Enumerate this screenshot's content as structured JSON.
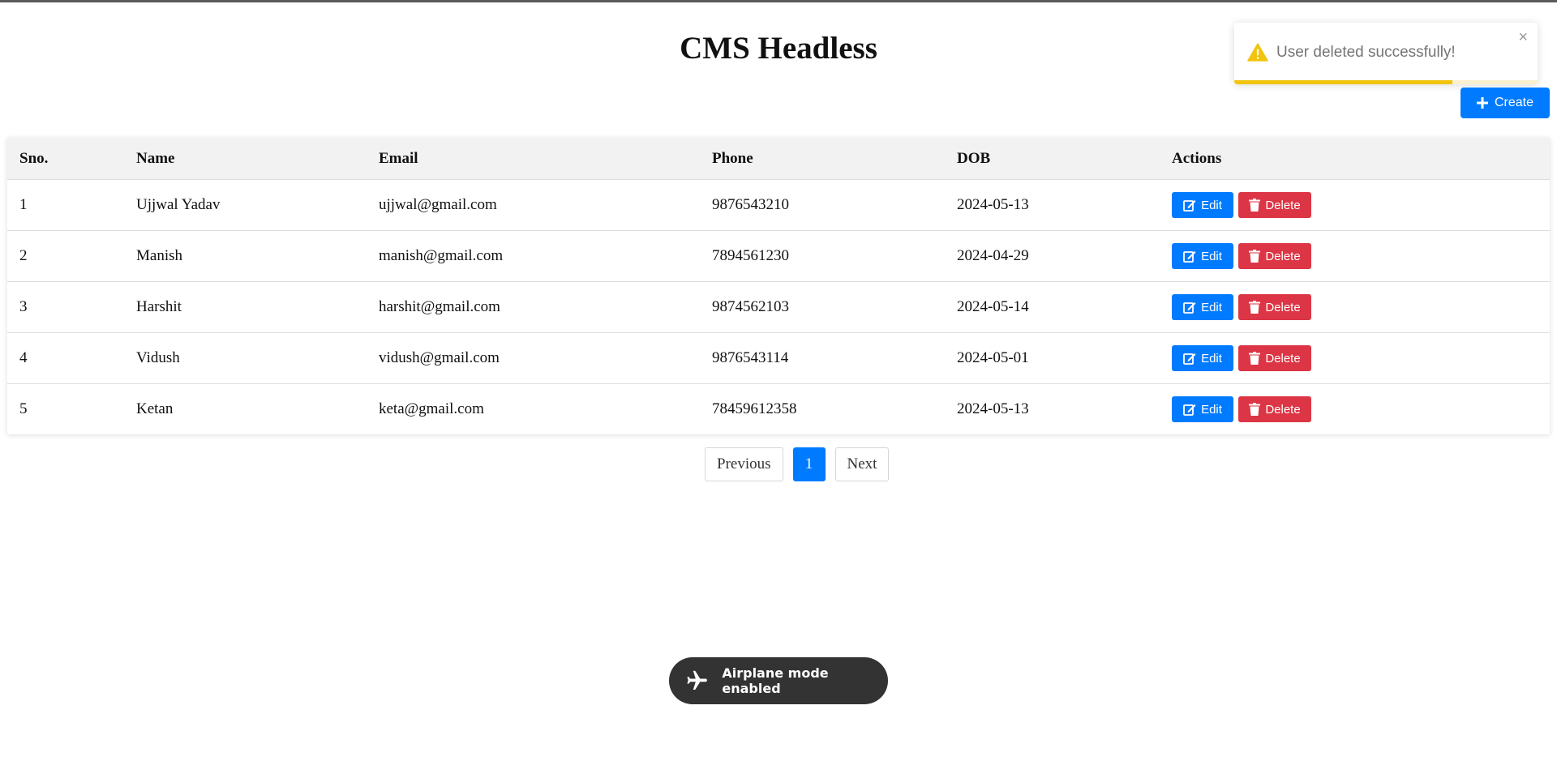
{
  "page": {
    "title": "CMS Headless"
  },
  "toast": {
    "message": "User deleted successfully!",
    "close_label": "×",
    "icon": "warning-icon",
    "accent_color": "#f1c40f",
    "progress": 0.72
  },
  "toolbar": {
    "create_label": "Create",
    "create_icon": "plus-icon"
  },
  "table": {
    "headers": [
      "Sno.",
      "Name",
      "Email",
      "Phone",
      "DOB",
      "Actions"
    ],
    "rows": [
      {
        "sno": "1",
        "name": "Ujjwal Yadav",
        "email": "ujjwal@gmail.com",
        "phone": "9876543210",
        "dob": "2024-05-13"
      },
      {
        "sno": "2",
        "name": "Manish",
        "email": "manish@gmail.com",
        "phone": "7894561230",
        "dob": "2024-04-29"
      },
      {
        "sno": "3",
        "name": "Harshit",
        "email": "harshit@gmail.com",
        "phone": "9874562103",
        "dob": "2024-05-14"
      },
      {
        "sno": "4",
        "name": "Vidush",
        "email": "vidush@gmail.com",
        "phone": "9876543114",
        "dob": "2024-05-01"
      },
      {
        "sno": "5",
        "name": "Ketan",
        "email": "keta@gmail.com",
        "phone": "78459612358",
        "dob": "2024-05-13"
      }
    ],
    "edit_label": "Edit",
    "delete_label": "Delete",
    "edit_color": "#007bff",
    "delete_color": "#dc3545"
  },
  "pagination": {
    "previous_label": "Previous",
    "current_page": "1",
    "next_label": "Next"
  },
  "system_toast": {
    "message": "Airplane mode enabled",
    "icon": "airplane-icon"
  }
}
